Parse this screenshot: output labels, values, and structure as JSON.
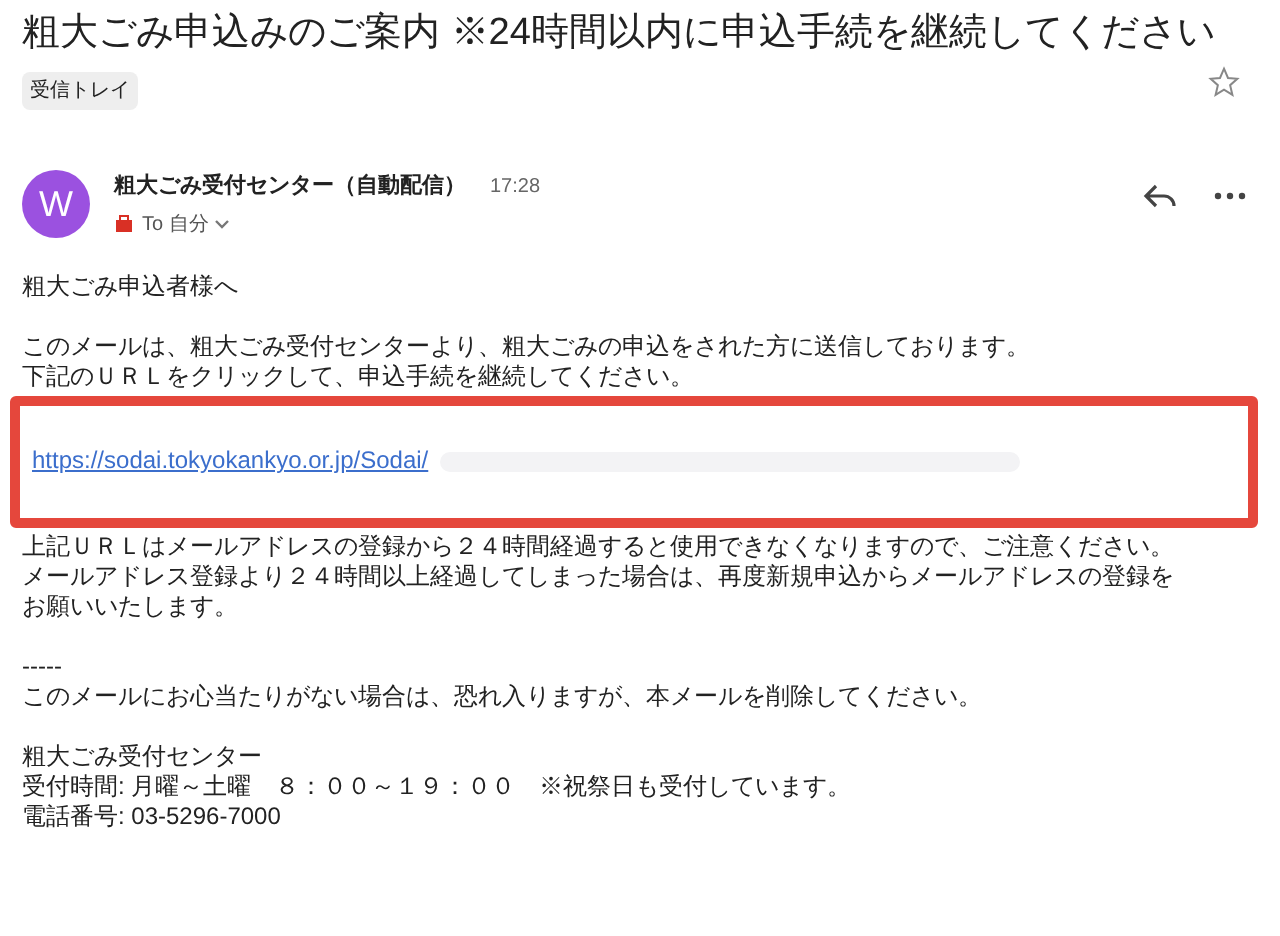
{
  "subject": "粗大ごみ申込みのご案内 ※24時間以内に申込手続を継続してください",
  "label": "受信トレイ",
  "starred": false,
  "sender": {
    "avatar": "W",
    "name": "粗大ごみ受付センター（自動配信）",
    "time": "17:28",
    "to": "To 自分"
  },
  "body": {
    "greeting": "粗大ごみ申込者様へ",
    "intro": [
      "このメールは、粗大ごみ受付センターより、粗大ごみの申込をされた方に送信しております。",
      "下記のＵＲＬをクリックして、申込手続を継続してください。"
    ],
    "link": "https://sodai.tokyokankyo.or.jp/Sodai/",
    "notice": [
      "上記ＵＲＬはメールアドレスの登録から２４時間経過すると使用できなくなりますので、ご注意ください。",
      "メールアドレス登録より２４時間以上経過してしまった場合は、再度新規申込からメールアドレスの登録を",
      "お願いいたします。"
    ],
    "separator": "-----",
    "disclaimer": "このメールにお心当たりがない場合は、恐れ入りますが、本メールを削除してください。",
    "signature": [
      "粗大ごみ受付センター",
      "受付時間: 月曜～土曜　８：００～１９：００　※祝祭日も受付しています。",
      "電話番号: 03-5296-7000"
    ]
  }
}
